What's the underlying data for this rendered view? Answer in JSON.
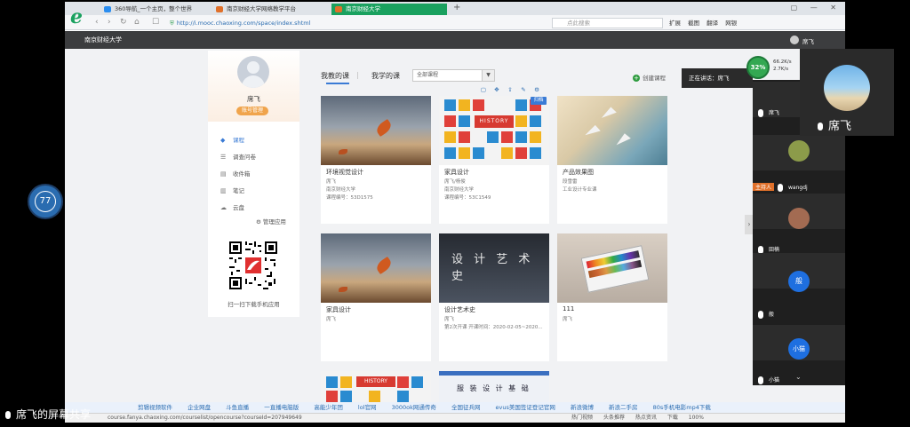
{
  "browser": {
    "tabs": [
      {
        "label": "360导航_一个主页，整个世界"
      },
      {
        "label": "南京财经大学网络教学平台"
      },
      {
        "label": "南京财经大学"
      }
    ],
    "new_tab": "+",
    "url": "http://i.mooc.chaoxing.com/space/index.shtml",
    "search_placeholder": "点此搜索",
    "toolbar": [
      "扩展",
      "截图",
      "翻译",
      "网银"
    ],
    "window_controls": "▢ — ✕"
  },
  "site": {
    "name": "南京财经大学",
    "user": "席飞"
  },
  "profile": {
    "name": "席飞",
    "badge": "账号管理"
  },
  "menu": [
    {
      "label": "课程",
      "icon": "course-icon",
      "glyph": "◆"
    },
    {
      "label": "调查问卷",
      "icon": "survey-icon",
      "glyph": "☰"
    },
    {
      "label": "收件箱",
      "icon": "inbox-icon",
      "glyph": "▤"
    },
    {
      "label": "笔记",
      "icon": "note-icon",
      "glyph": "▥"
    },
    {
      "label": "云盘",
      "icon": "cloud-icon",
      "glyph": "☁"
    }
  ],
  "manage_apps": "管理应用",
  "qr_caption": "扫一扫下载手机应用",
  "main": {
    "tab_teach": "我教的课",
    "tab_sep": "|",
    "tab_learn": "我学的课",
    "filter_value": "全部课程",
    "create_course": "创建课程",
    "archive_tag": "归档"
  },
  "courses": [
    {
      "title": "环境视觉设计",
      "lines": [
        "席飞",
        "南京财经大学",
        "课程编号：53D1575"
      ]
    },
    {
      "title": "家具设计",
      "lines": [
        "席飞/杨俊",
        "南京财经大学",
        "课程编号：53C1549"
      ]
    },
    {
      "title": "产品效果图",
      "lines": [
        "段雪雷",
        "工业设计专业课"
      ]
    },
    {
      "title": "家具设计",
      "lines": [
        "席飞"
      ]
    },
    {
      "title": "设计艺术史",
      "lines": [
        "席飞",
        "第2次开课 开课时间：2020-02-05~2020..."
      ]
    },
    {
      "title": "111",
      "lines": [
        "席飞"
      ]
    }
  ],
  "thumb_text": {
    "history": "HISTORY",
    "art_cn": "设 计 艺 术 史",
    "fashion": "服 装 设 计 基 础"
  },
  "favorites": [
    "剪辑视频软件",
    "企业网盘",
    "斗鱼直播",
    "一直播电脑版",
    "高能少年团",
    "lol官网",
    "3000ok网通传奇",
    "全国征兵网",
    "evus美国签证登记官网",
    "新浪微博",
    "新浪二手房",
    "80s手机电影mp4下载"
  ],
  "status": {
    "url": "course.fanya.chaoxing.com/courselist/opencourse?courseId=207949649",
    "items": [
      "热门视频",
      "头条推荐",
      "热点资讯",
      "下载",
      "100%"
    ]
  },
  "overlay": {
    "badge_number": "77",
    "speaking": "正在讲话：席飞",
    "cpu": "32%",
    "net_up": "66.2K/s",
    "net_down": "2.7K/s",
    "presenter_name": "席飞",
    "share_label": "席飞的屏幕共享"
  },
  "participants": [
    {
      "name": "席飞",
      "host": false,
      "color": "#6d8fa8",
      "initial": ""
    },
    {
      "name": "wangdj",
      "host": true,
      "host_label": "主持人",
      "color": "#8c9b4a",
      "initial": ""
    },
    {
      "name": "田楠",
      "host": false,
      "color": "#a36b52",
      "initial": ""
    },
    {
      "name": "般",
      "host": false,
      "color": "#1e6fe0",
      "initial": "般"
    },
    {
      "name": "小猫",
      "host": false,
      "color": "#1e6fe0",
      "initial": "小猫"
    }
  ],
  "colors": {
    "active_tab": "#1aa15f",
    "accent": "#3a7bd5",
    "header": "#3c3d3f"
  }
}
